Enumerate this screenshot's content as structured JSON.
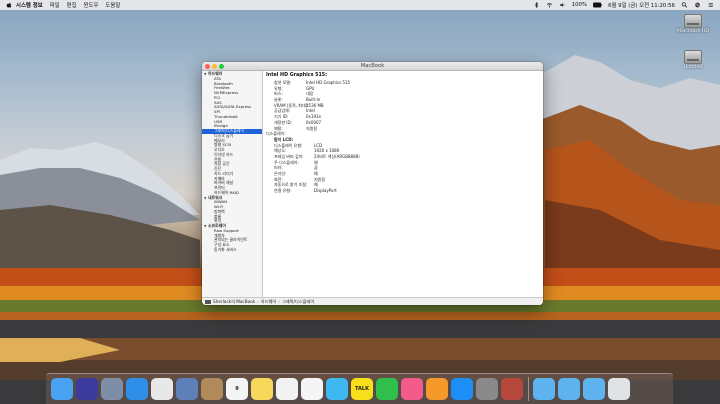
{
  "menubar": {
    "items": [
      "시스템 정보",
      "파일",
      "편집",
      "윈도우",
      "도움말"
    ],
    "battery": "100%",
    "clock": "6월 9일 (금) 오전 11:20:56"
  },
  "desktop": {
    "drives": [
      {
        "label": "Macintosh HD",
        "icon": "hard-drive-icon"
      },
      {
        "label": "Untitled",
        "icon": "hard-drive-icon"
      }
    ]
  },
  "window": {
    "title": "MacBook",
    "sidebar": [
      {
        "label": "하드웨어",
        "level": 0,
        "expanded": true
      },
      {
        "label": "ATA",
        "level": 1
      },
      {
        "label": "Bluetooth",
        "level": 1
      },
      {
        "label": "FireWire",
        "level": 1
      },
      {
        "label": "NVMExpress",
        "level": 1
      },
      {
        "label": "PCI",
        "level": 1
      },
      {
        "label": "SAS",
        "level": 1
      },
      {
        "label": "SATA/SATA Express",
        "level": 1
      },
      {
        "label": "SPI",
        "level": 1
      },
      {
        "label": "Thunderbolt",
        "level": 1
      },
      {
        "label": "USB",
        "level": 1
      },
      {
        "label": "iBridge",
        "level": 1
      },
      {
        "label": "그래픽/디스플레이",
        "level": 1,
        "selected": true
      },
      {
        "label": "디스크 굽기",
        "level": 1
      },
      {
        "label": "메모리",
        "level": 1
      },
      {
        "label": "병렬 SCSI",
        "level": 1
      },
      {
        "label": "오디오",
        "level": 1
      },
      {
        "label": "이더넷 카드",
        "level": 1
      },
      {
        "label": "전원",
        "level": 1
      },
      {
        "label": "저장 공간",
        "level": 1
      },
      {
        "label": "진단",
        "level": 1
      },
      {
        "label": "카드 리더기",
        "level": 1
      },
      {
        "label": "카메라",
        "level": 1
      },
      {
        "label": "파이버 채널",
        "level": 1
      },
      {
        "label": "프린터",
        "level": 1
      },
      {
        "label": "하드웨어 RAID",
        "level": 1
      },
      {
        "label": "네트워크",
        "level": 0,
        "expanded": true
      },
      {
        "label": "WWAN",
        "level": 1
      },
      {
        "label": "Wi-Fi",
        "level": 1
      },
      {
        "label": "방화벽",
        "level": 1
      },
      {
        "label": "볼륨",
        "level": 1
      },
      {
        "label": "위치",
        "level": 1
      },
      {
        "label": "소프트웨어",
        "level": 0,
        "expanded": true
      },
      {
        "label": "Raw Support",
        "level": 1
      },
      {
        "label": "개발자",
        "level": 1
      },
      {
        "label": "관리되는 클라이언트",
        "level": 1
      },
      {
        "label": "구성 요소",
        "level": 1
      },
      {
        "label": "동기화 서비스",
        "level": 1
      }
    ],
    "detail": {
      "title": "Intel HD Graphics 515:",
      "properties": [
        {
          "key": "칩셋 모델:",
          "value": "Intel HD Graphics 515"
        },
        {
          "key": "유형:",
          "value": "GPU"
        },
        {
          "key": "버스:",
          "value": "내장"
        },
        {
          "key": "슬롯:",
          "value": "Built-In"
        },
        {
          "key": "VRAM (동적, 최대):",
          "value": "1536 MB"
        },
        {
          "key": "공급업체:",
          "value": "Intel"
        },
        {
          "key": "기기 ID:",
          "value": "0x191e"
        },
        {
          "key": "개정판 ID:",
          "value": "0x0007"
        },
        {
          "key": "메탈:",
          "value": "지원됨"
        }
      ],
      "displays_label": "디스플레이:",
      "display_name": "탐지 LCD:",
      "display_props": [
        {
          "key": "디스플레이 유형:",
          "value": "LCD"
        },
        {
          "key": "해상도:",
          "value": "1920 x 1080"
        },
        {
          "key": "프레임 버퍼 깊이:",
          "value": "24비트 색상(ARGB8888)"
        },
        {
          "key": "주 디스플레이:",
          "value": "예"
        },
        {
          "key": "미러:",
          "value": "끔"
        },
        {
          "key": "온라인:",
          "value": "예"
        },
        {
          "key": "회전:",
          "value": "지원됨"
        },
        {
          "key": "자동으로 밝기 조절:",
          "value": "예"
        },
        {
          "key": "연결 유형:",
          "value": "DisplayPort"
        }
      ]
    },
    "statusbar": {
      "computer": "Sherlock의 MacBook",
      "section": "하드웨어",
      "item": "그래픽/디스플레이"
    }
  },
  "dock": {
    "apps": [
      {
        "name": "finder-icon",
        "color": "#4aa3f2"
      },
      {
        "name": "siri-icon",
        "color": "#3b3b9e"
      },
      {
        "name": "launchpad-icon",
        "color": "#7e8ea6"
      },
      {
        "name": "safari-icon",
        "color": "#2f8fe8"
      },
      {
        "name": "chrome-icon",
        "color": "#e8e8e8"
      },
      {
        "name": "preview-icon",
        "color": "#5e7fb8"
      },
      {
        "name": "contacts-icon",
        "color": "#b08a5a"
      },
      {
        "name": "calendar-icon",
        "color": "#f4f4f4",
        "label": "9"
      },
      {
        "name": "notes-icon",
        "color": "#f7d75c"
      },
      {
        "name": "reminders-icon",
        "color": "#f2f2f2"
      },
      {
        "name": "photos-icon",
        "color": "#f5f5f5"
      },
      {
        "name": "messages-icon",
        "color": "#3fb8f2"
      },
      {
        "name": "kakaotalk-icon",
        "color": "#f9df1a",
        "label": "TALK"
      },
      {
        "name": "facetime-icon",
        "color": "#2fbf4a"
      },
      {
        "name": "music-icon",
        "color": "#f35b8d"
      },
      {
        "name": "books-icon",
        "color": "#f59a2a"
      },
      {
        "name": "app-store-icon",
        "color": "#1c8ef5"
      },
      {
        "name": "system-preferences-icon",
        "color": "#8a8a8a"
      },
      {
        "name": "system-information-icon",
        "color": "#b5473d"
      }
    ],
    "folders": [
      {
        "name": "applications-folder-icon",
        "color": "#5eb3ef"
      },
      {
        "name": "documents-folder-icon",
        "color": "#5eb3ef"
      },
      {
        "name": "downloads-folder-icon",
        "color": "#5eb3ef"
      },
      {
        "name": "trash-icon",
        "color": "#dfe3e6"
      }
    ]
  }
}
